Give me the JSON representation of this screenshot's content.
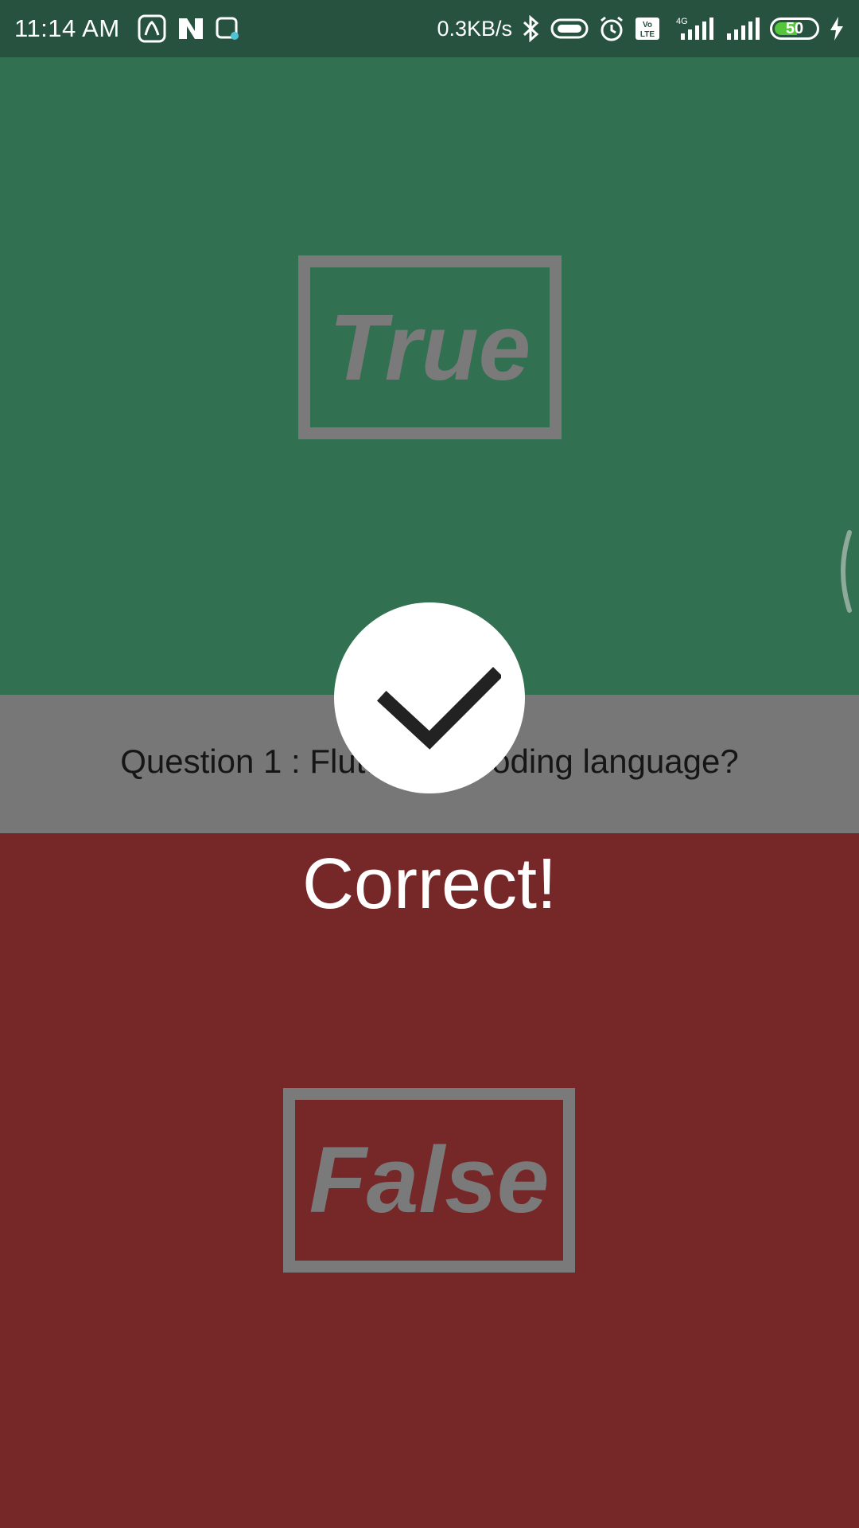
{
  "status_bar": {
    "time": "11:14 AM",
    "network_speed": "0.3KB/s",
    "battery_level": "50",
    "icons": [
      "saavn-icon",
      "n-app-icon",
      "saavn-notify-icon",
      "bluetooth-icon",
      "vpn-key-icon",
      "alarm-icon",
      "volte-icon",
      "signal-4g-icon",
      "signal-icon",
      "battery-icon",
      "charging-icon"
    ]
  },
  "quiz": {
    "true_label": "True",
    "false_label": "False",
    "question": "Question 1 : Flutter is a coding language?",
    "feedback": "Correct!",
    "feedback_icon": "checkmark-icon"
  },
  "colors": {
    "true_bg": "#327052",
    "false_bg": "#762728",
    "question_bg": "#777777",
    "status_bar_bg": "#27523f"
  }
}
